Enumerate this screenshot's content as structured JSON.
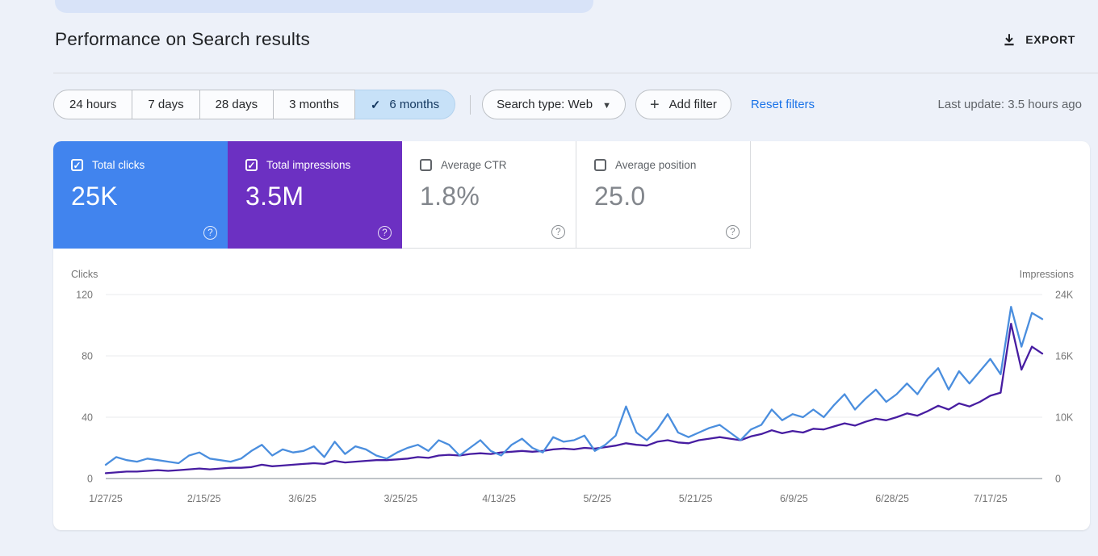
{
  "header": {
    "title": "Performance on Search results",
    "export_label": "EXPORT"
  },
  "toolbar": {
    "date_ranges": [
      {
        "label": "24 hours",
        "selected": false
      },
      {
        "label": "7 days",
        "selected": false
      },
      {
        "label": "28 days",
        "selected": false
      },
      {
        "label": "3 months",
        "selected": false
      },
      {
        "label": "6 months",
        "selected": true
      }
    ],
    "selected_chip_bg": "#c7e1f8",
    "search_type_label": "Search type: Web",
    "add_filter_label": "Add filter",
    "reset_filters_label": "Reset filters",
    "reset_link_color": "#1a73e8",
    "last_update": "Last update: 3.5 hours ago"
  },
  "metrics": [
    {
      "label": "Total clicks",
      "value": "25K",
      "checked": true,
      "color": "#4184ee"
    },
    {
      "label": "Total impressions",
      "value": "3.5M",
      "checked": true,
      "color": "#6c30c2"
    },
    {
      "label": "Average CTR",
      "value": "1.8%",
      "checked": false
    },
    {
      "label": "Average position",
      "value": "25.0",
      "checked": false
    }
  ],
  "chart_data": {
    "type": "line",
    "title": "Performance on Search results",
    "grid": true,
    "left_axis": {
      "label": "Clicks",
      "ticks": [
        "120",
        "80",
        "40",
        "0"
      ],
      "max": 120
    },
    "right_axis": {
      "label": "Impressions",
      "ticks": [
        "24K",
        "16K",
        "10K",
        "0"
      ],
      "max": 24
    },
    "x_ticks": [
      "1/27/25",
      "2/15/25",
      "3/6/25",
      "3/25/25",
      "4/13/25",
      "5/2/25",
      "5/21/25",
      "6/9/25",
      "6/28/25",
      "7/17/25"
    ],
    "label_interval_days": 19,
    "total_days": 181,
    "point_interval_days": 2,
    "series": [
      {
        "name": "Total impressions",
        "axis": "right",
        "unit": "K",
        "color": "#471da1",
        "values": [
          0.7,
          0.8,
          0.9,
          0.9,
          1.0,
          1.1,
          1.0,
          1.1,
          1.2,
          1.3,
          1.2,
          1.3,
          1.4,
          1.4,
          1.5,
          1.8,
          1.6,
          1.7,
          1.8,
          1.9,
          2.0,
          1.9,
          2.3,
          2.1,
          2.2,
          2.3,
          2.4,
          2.4,
          2.5,
          2.6,
          2.8,
          2.7,
          3.0,
          3.1,
          3.0,
          3.2,
          3.3,
          3.2,
          3.4,
          3.5,
          3.6,
          3.5,
          3.6,
          3.8,
          3.9,
          3.8,
          4.0,
          3.9,
          4.1,
          4.3,
          4.6,
          4.4,
          4.3,
          4.8,
          5.0,
          4.7,
          4.6,
          5.0,
          5.2,
          5.4,
          5.2,
          5.0,
          5.5,
          5.8,
          6.3,
          5.9,
          6.2,
          6.0,
          6.5,
          6.4,
          6.8,
          7.2,
          6.9,
          7.4,
          7.8,
          7.6,
          8.0,
          8.5,
          8.2,
          8.8,
          9.5,
          9.0,
          9.8,
          9.4,
          10.0,
          10.8,
          11.2,
          20.2,
          14.2,
          17.2,
          16.3
        ]
      },
      {
        "name": "Total clicks",
        "axis": "left",
        "unit": "",
        "color": "#4a8ede",
        "values": [
          9,
          14,
          12,
          11,
          13,
          12,
          11,
          10,
          15,
          17,
          13,
          12,
          11,
          13,
          18,
          22,
          15,
          19,
          17,
          18,
          21,
          14,
          24,
          16,
          21,
          19,
          15,
          13,
          17,
          20,
          22,
          18,
          25,
          22,
          15,
          20,
          25,
          18,
          15,
          22,
          26,
          20,
          17,
          27,
          24,
          25,
          28,
          18,
          22,
          28,
          47,
          30,
          25,
          32,
          42,
          30,
          27,
          30,
          33,
          35,
          30,
          25,
          32,
          35,
          45,
          38,
          42,
          40,
          45,
          40,
          48,
          55,
          45,
          52,
          58,
          50,
          55,
          62,
          55,
          65,
          72,
          58,
          70,
          62,
          70,
          78,
          68,
          112,
          86,
          108,
          104
        ]
      }
    ]
  }
}
